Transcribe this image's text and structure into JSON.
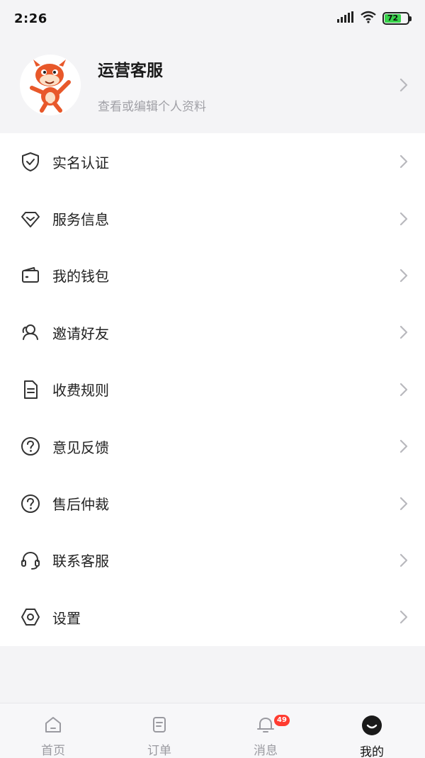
{
  "status_bar": {
    "time": "2:26",
    "battery_level": "72"
  },
  "profile": {
    "name": "运营客服",
    "subtitle": "查看或编辑个人资料"
  },
  "menu": [
    {
      "id": "realname",
      "label": "实名认证",
      "icon": "shield-check-icon"
    },
    {
      "id": "service",
      "label": "服务信息",
      "icon": "diamond-icon"
    },
    {
      "id": "wallet",
      "label": "我的钱包",
      "icon": "wallet-icon"
    },
    {
      "id": "invite",
      "label": "邀请好友",
      "icon": "friends-icon"
    },
    {
      "id": "fees",
      "label": "收费规则",
      "icon": "document-icon"
    },
    {
      "id": "feedback",
      "label": "意见反馈",
      "icon": "question-icon"
    },
    {
      "id": "arbitration",
      "label": "售后仲裁",
      "icon": "question-icon"
    },
    {
      "id": "support",
      "label": "联系客服",
      "icon": "headset-icon"
    },
    {
      "id": "settings",
      "label": "设置",
      "icon": "hexagon-settings-icon"
    }
  ],
  "tabs": [
    {
      "label": "首页",
      "icon": "home-icon"
    },
    {
      "label": "订单",
      "icon": "order-icon"
    },
    {
      "label": "消息",
      "icon": "bell-icon",
      "badge": "49"
    },
    {
      "label": "我的",
      "icon": "profile-icon",
      "active": true
    }
  ],
  "colors": {
    "badge": "#ff3b30",
    "battery": "#37d34a",
    "avatar_brand": "#e8582a"
  }
}
